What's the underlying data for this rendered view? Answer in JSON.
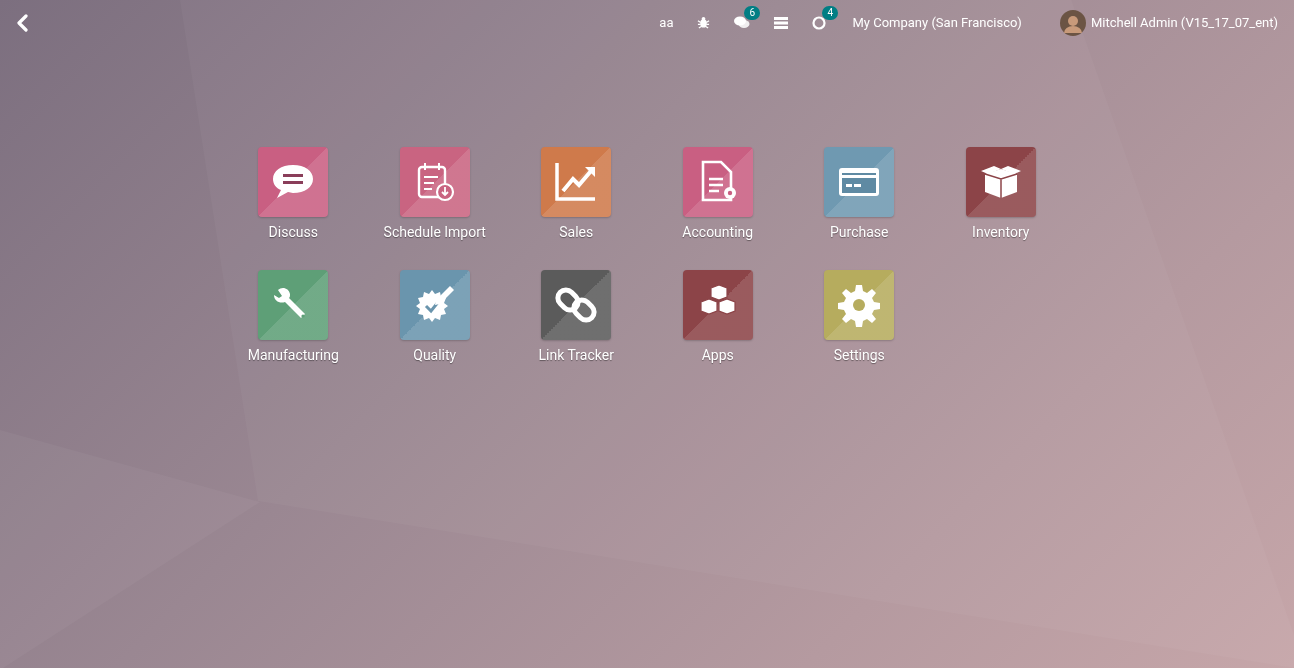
{
  "navbar": {
    "debug_label": "aa",
    "messages_count": "6",
    "activities_count": "4",
    "company": "My Company (San Francisco)",
    "user": "Mitchell Admin (V15_17_07_ent)"
  },
  "apps": [
    {
      "name": "Discuss",
      "kind": "chat",
      "color": "#c95f82"
    },
    {
      "name": "Schedule Import",
      "kind": "calendar",
      "color": "#c96481"
    },
    {
      "name": "Sales",
      "kind": "chart",
      "color": "#cf7a4b"
    },
    {
      "name": "Accounting",
      "kind": "document",
      "color": "#c95f82"
    },
    {
      "name": "Purchase",
      "kind": "card",
      "color": "#6f99b1"
    },
    {
      "name": "Inventory",
      "kind": "box",
      "color": "#8c4448"
    },
    {
      "name": "Manufacturing",
      "kind": "wrench",
      "color": "#5e9f77"
    },
    {
      "name": "Quality",
      "kind": "badge",
      "color": "#6a95ad"
    },
    {
      "name": "Link Tracker",
      "kind": "link",
      "color": "#5b5b5b"
    },
    {
      "name": "Apps",
      "kind": "cubes",
      "color": "#8c4448"
    },
    {
      "name": "Settings",
      "kind": "gear",
      "color": "#b6ac5e"
    }
  ]
}
